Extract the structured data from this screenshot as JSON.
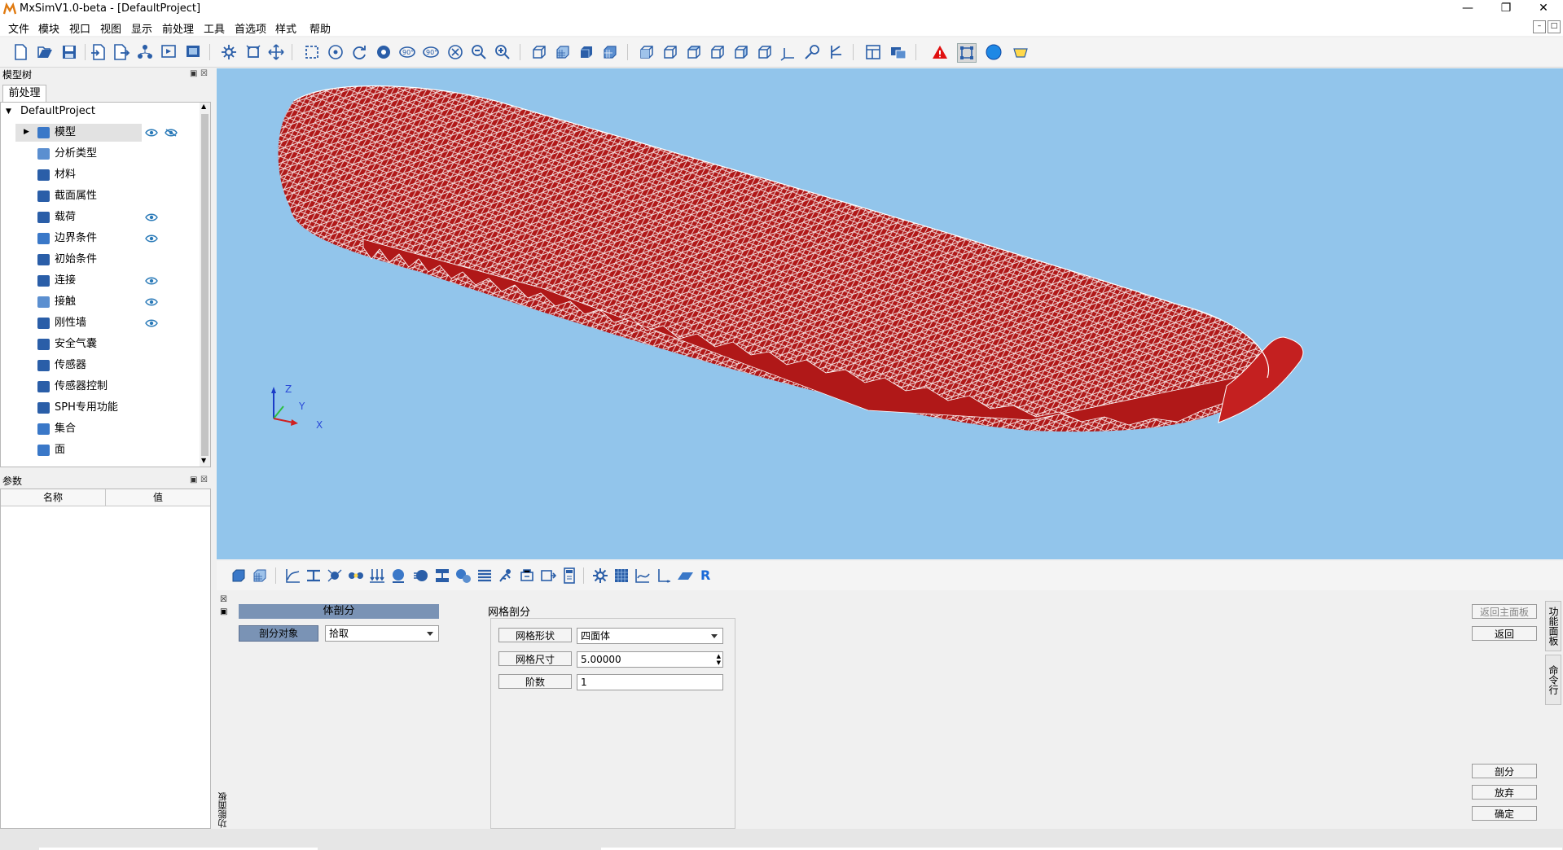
{
  "window": {
    "title": "MxSimV1.0-beta - [DefaultProject]",
    "minimize_glyph": "—",
    "restore_glyph": "❐",
    "close_glyph": "✕"
  },
  "menu": [
    "文件",
    "模块",
    "视口",
    "视图",
    "显示",
    "前处理",
    "工具",
    "首选项",
    "样式",
    "帮助"
  ],
  "model_tree": {
    "title": "模型树",
    "tab": "前处理",
    "root": "DefaultProject",
    "items": [
      {
        "label": "模型",
        "icon": "cube-icon",
        "eye": true,
        "hidden_eye": true
      },
      {
        "label": "分析类型",
        "icon": "analysis-type-icon",
        "eye": false
      },
      {
        "label": "材料",
        "icon": "material-curve-icon",
        "eye": false
      },
      {
        "label": "截面属性",
        "icon": "section-icon",
        "eye": false
      },
      {
        "label": "载荷",
        "icon": "load-arrows-icon",
        "eye": true
      },
      {
        "label": "边界条件",
        "icon": "boundary-icon",
        "eye": true
      },
      {
        "label": "初始条件",
        "icon": "initial-condition-icon",
        "eye": false
      },
      {
        "label": "连接",
        "icon": "connection-icon",
        "eye": true
      },
      {
        "label": "接触",
        "icon": "contact-icon",
        "eye": true
      },
      {
        "label": "刚性墙",
        "icon": "rigid-wall-icon",
        "eye": true
      },
      {
        "label": "安全气囊",
        "icon": "airbag-icon",
        "eye": false
      },
      {
        "label": "传感器",
        "icon": "sensor-icon",
        "eye": false
      },
      {
        "label": "传感器控制",
        "icon": "sensor-control-icon",
        "eye": false
      },
      {
        "label": "SPH专用功能",
        "icon": "sph-icon",
        "eye": false
      },
      {
        "label": "集合",
        "icon": "set-icon",
        "eye": false
      },
      {
        "label": "面",
        "icon": "surface-icon",
        "eye": false
      }
    ]
  },
  "params": {
    "title": "参数",
    "col_name": "名称",
    "col_value": "值"
  },
  "axes": {
    "z": "Z",
    "y": "Y",
    "x": "X"
  },
  "bottom_toolbar_r": "R",
  "func_panel": {
    "vertical_label": "功能面板",
    "body_mesh_header": "体剖分",
    "mesh_target_label": "剖分对象",
    "mesh_target_value": "拾取",
    "mesh_group_title": "网格剖分",
    "mesh_shape_label": "网格形状",
    "mesh_shape_value": "四面体",
    "mesh_size_label": "网格尺寸",
    "mesh_size_value": "5.00000",
    "order_label": "阶数",
    "order_value": "1",
    "btn_back_main": "返回主面板",
    "btn_back": "返回",
    "btn_mesh": "剖分",
    "btn_discard": "放弃",
    "btn_confirm": "确定",
    "side_tab_func": "功能面板",
    "side_tab_cmd": "命令行"
  },
  "colors": {
    "viewport_bg": "#92c5eb",
    "mesh_fill": "#b01818",
    "mesh_lines": "#ffffff",
    "header_blue": "#7a93b5"
  }
}
